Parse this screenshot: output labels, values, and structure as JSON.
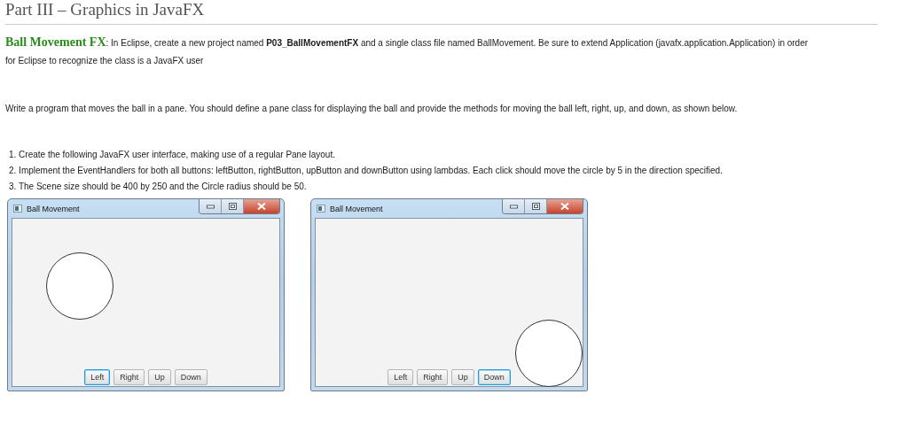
{
  "heading": "Part III – Graphics in JavaFX",
  "intro": {
    "lead": "Ball Movement FX",
    "text": ": In Eclipse, create a new project named **P03_BallMovementFX** and a single class file named BallMovement.  Be sure to extend Application (javafx.application.Application) in order for Eclipse to recognize the class is a JavaFX user"
  },
  "task": "Write a program that moves the ball in a pane. You should define a pane class for displaying the ball and provide the methods for moving the ball left, right, up, and down, as shown below.",
  "steps": [
    "1. Create the following JavaFX user interface, making use of a regular Pane layout.",
    "2. Implement the EventHandlers for both all buttons: leftButton, rightButton, upButton and downButton using lambdas.  Each click should move the circle by 5 in the direction specified.",
    "3. The Scene size should be 400 by 250 and the Circle radius should be 50."
  ],
  "windows": [
    {
      "title": "Ball Movement",
      "ball_in_corner": false,
      "buttons": [
        {
          "label": "Left",
          "selected": true
        },
        {
          "label": "Right",
          "selected": false
        },
        {
          "label": "Up",
          "selected": false
        },
        {
          "label": "Down",
          "selected": false
        }
      ]
    },
    {
      "title": "Ball Movement",
      "ball_in_corner": true,
      "buttons": [
        {
          "label": "Left",
          "selected": false
        },
        {
          "label": "Right",
          "selected": false
        },
        {
          "label": "Up",
          "selected": false
        },
        {
          "label": "Down",
          "selected": true
        }
      ]
    }
  ]
}
